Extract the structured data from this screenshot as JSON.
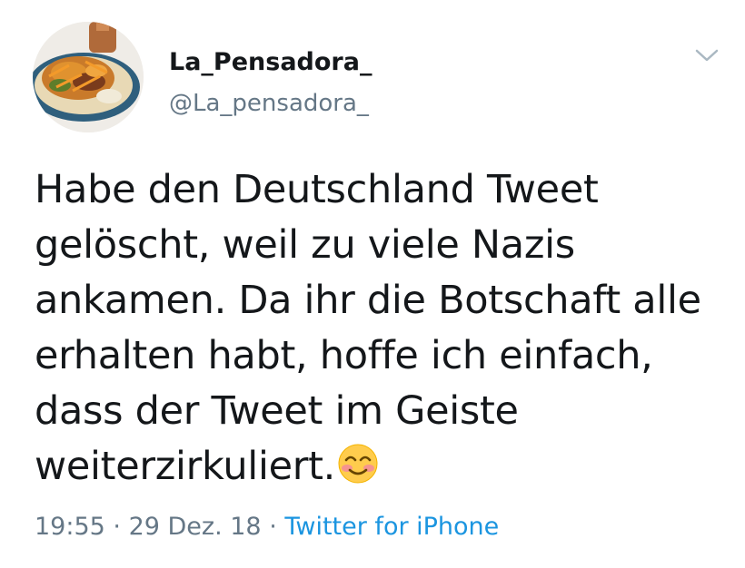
{
  "user": {
    "display_name": "La_Pensadora_",
    "handle": "@La_pensadora_"
  },
  "tweet": {
    "text": "Habe den Deutschland Tweet\ngelöscht, weil zu viele Nazis\nankamen. Da ihr die Botschaft alle\nerhalten habt, hoffe ich einfach,\ndass der Tweet im Geiste\nweiterzirkuliert.",
    "emoji": "smiling-face-with-smiling-eyes"
  },
  "meta": {
    "time": "19:55",
    "separator1": " · ",
    "date": "29 Dez. 18",
    "separator2": " · ",
    "source": "Twitter for iPhone"
  },
  "icons": {
    "more": "chevron-down-icon"
  },
  "colors": {
    "text": "#14171a",
    "secondary": "#657786",
    "link": "#1b95e0"
  }
}
